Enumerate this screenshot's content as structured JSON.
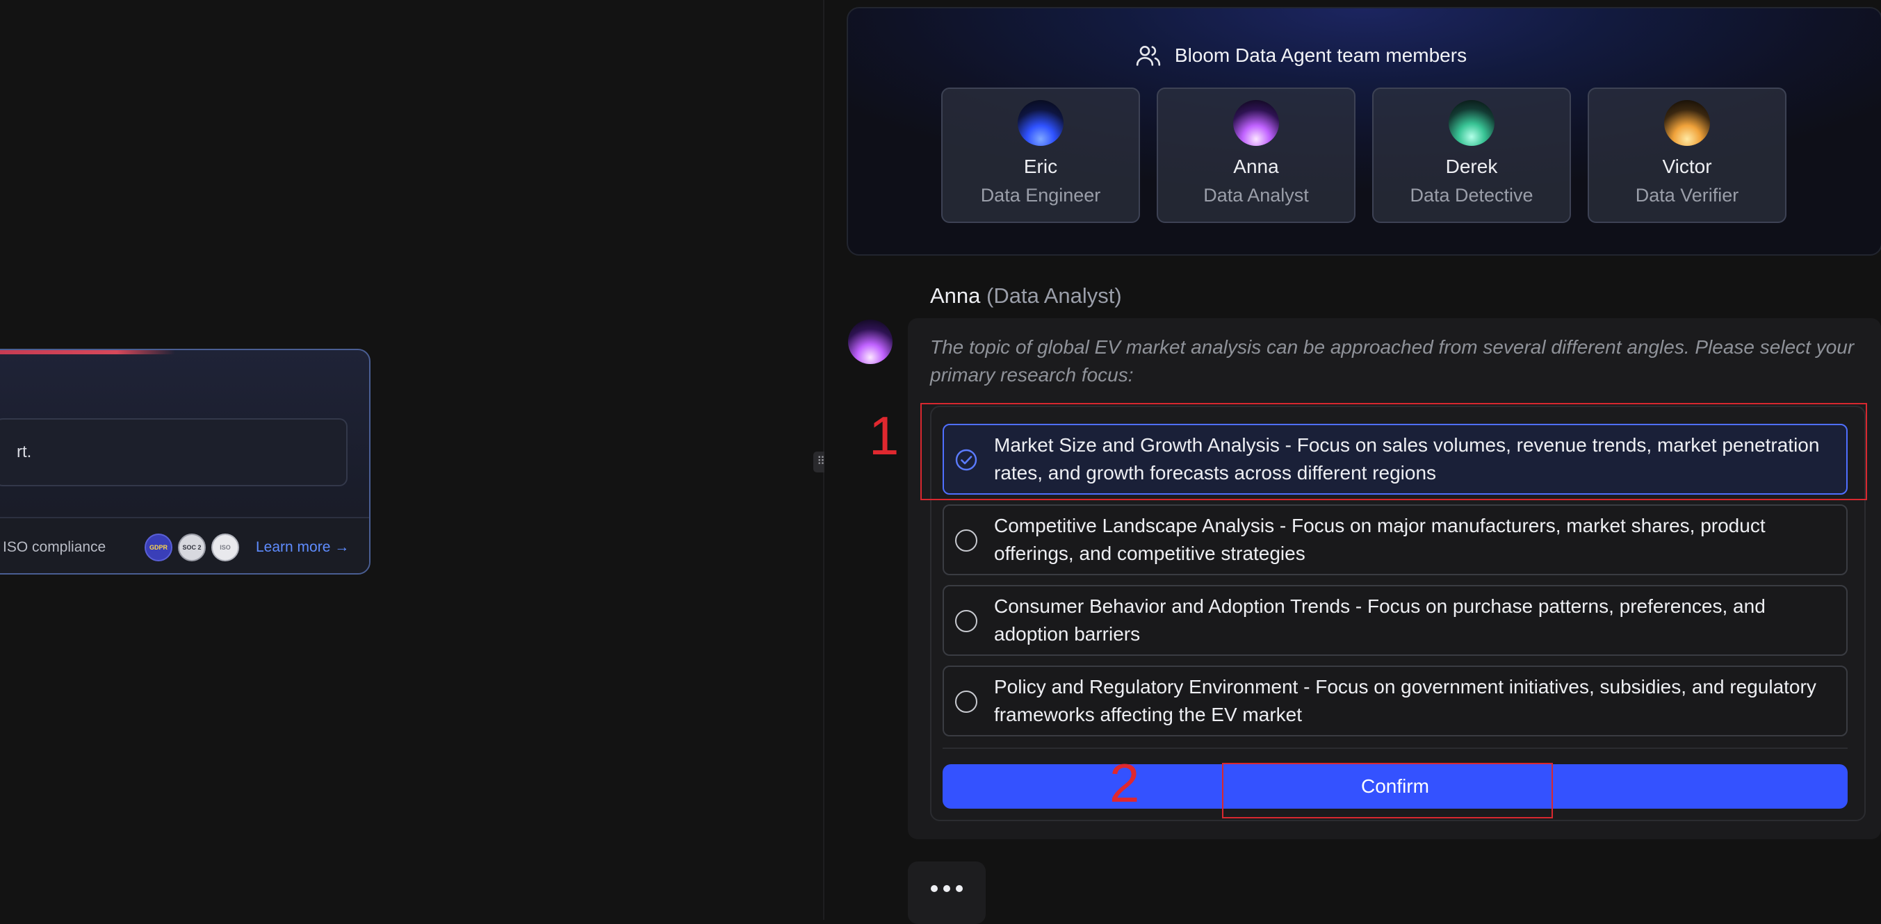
{
  "left_card": {
    "prompt_text": "rt.",
    "compliance_text": "ISO compliance",
    "badges": [
      {
        "label": "GDPR",
        "icon": "gdpr-badge-icon"
      },
      {
        "label": "SOC 2",
        "icon": "soc2-badge-icon"
      },
      {
        "label": "ISO",
        "icon": "iso-badge-icon"
      }
    ],
    "learn_more": "Learn more →"
  },
  "drag_handle_glyph": "⠿",
  "team": {
    "title": "Bloom Data Agent team members",
    "icon": "users-icon",
    "members": [
      {
        "name": "Eric",
        "role": "Data Engineer",
        "color": "#2f52ff"
      },
      {
        "name": "Anna",
        "role": "Data Analyst",
        "color": "#c062ff"
      },
      {
        "name": "Derek",
        "role": "Data Detective",
        "color": "#39c495"
      },
      {
        "name": "Victor",
        "role": "Data Verifier",
        "color": "#f0a23a"
      }
    ]
  },
  "message": {
    "speaker_name": "Anna",
    "speaker_role": "(Data Analyst)",
    "intro": "The topic of global EV market analysis can be approached from several different angles. Please select your primary research focus:",
    "options": [
      {
        "text": "Market Size and Growth Analysis - Focus on sales volumes, revenue trends, market penetration rates, and growth forecasts across different regions",
        "selected": true
      },
      {
        "text": "Competitive Landscape Analysis - Focus on major manufacturers, market shares, product offerings, and competitive strategies",
        "selected": false
      },
      {
        "text": "Consumer Behavior and Adoption Trends - Focus on purchase patterns, preferences, and adoption barriers",
        "selected": false
      },
      {
        "text": "Policy and Regulatory Environment - Focus on government initiatives, subsidies, and regulatory frameworks affecting the EV market",
        "selected": false
      }
    ],
    "confirm_label": "Confirm"
  },
  "annotations": {
    "label_1": "1",
    "label_2": "2"
  },
  "colors": {
    "accent": "#3452ff",
    "selected_border": "#4f6fff",
    "annotation": "#d8282f"
  }
}
